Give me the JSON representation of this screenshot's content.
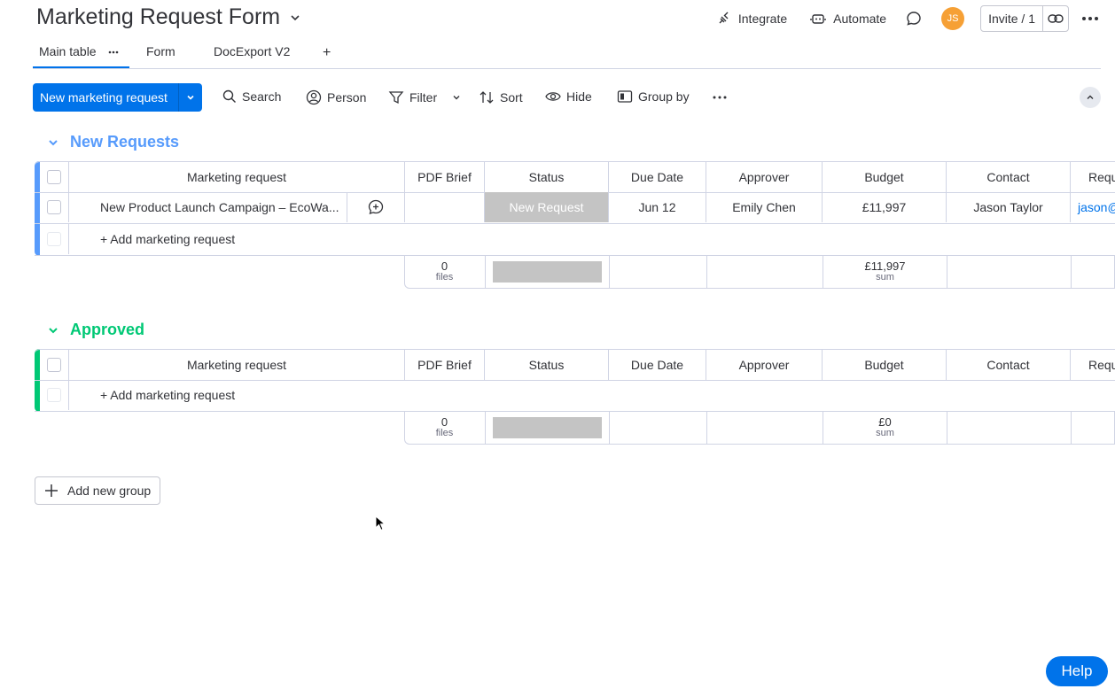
{
  "board": {
    "title": "Marketing Request Form",
    "top_actions": {
      "integrate": "Integrate",
      "automate": "Automate",
      "avatar_initials": "JS",
      "invite": "Invite / 1"
    },
    "tabs": {
      "main": "Main table",
      "form": "Form",
      "docexport": "DocExport V2",
      "add": "+"
    }
  },
  "toolbar": {
    "new_item": "New marketing request",
    "search": "Search",
    "person": "Person",
    "filter": "Filter",
    "sort": "Sort",
    "hide": "Hide",
    "group_by": "Group by"
  },
  "columns": [
    "Marketing request",
    "PDF Brief",
    "Status",
    "Due Date",
    "Approver",
    "Budget",
    "Contact",
    "Requ"
  ],
  "groups": [
    {
      "name": "New Requests",
      "color": "#579bfc",
      "rows": [
        {
          "marketing_request": "New Product Launch Campaign – EcoWa...",
          "status": "New Request",
          "due_date": "Jun 12",
          "approver": "Emily Chen",
          "budget": "£11,997",
          "contact": "Jason Taylor",
          "requester": "jason@"
        }
      ],
      "add_label": "+ Add marketing request",
      "summary": {
        "files_count": "0",
        "files_label": "files",
        "budget_sum": "£11,997",
        "sum_label": "sum"
      }
    },
    {
      "name": "Approved",
      "color": "#00c875",
      "rows": [],
      "add_label": "+ Add marketing request",
      "summary": {
        "files_count": "0",
        "files_label": "files",
        "budget_sum": "£0",
        "sum_label": "sum"
      }
    }
  ],
  "add_group": "Add new group",
  "help": "Help",
  "colors": {
    "primary": "#0073ea",
    "status_gray": "#c4c4c4",
    "border": "#d0d4e4"
  }
}
